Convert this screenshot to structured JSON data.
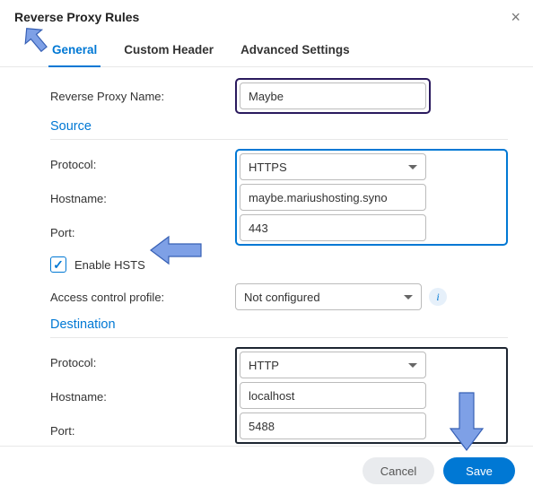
{
  "dialog": {
    "title": "Reverse Proxy Rules"
  },
  "tabs": {
    "general": "General",
    "custom_header": "Custom Header",
    "advanced": "Advanced Settings"
  },
  "fields": {
    "name_label": "Reverse Proxy Name:",
    "name_value": "Maybe",
    "source_heading": "Source",
    "protocol_label": "Protocol:",
    "src_protocol": "HTTPS",
    "hostname_label": "Hostname:",
    "src_hostname": "maybe.mariushosting.syno",
    "port_label": "Port:",
    "src_port": "443",
    "hsts_label": "Enable HSTS",
    "hsts_checked": true,
    "acp_label": "Access control profile:",
    "acp_value": "Not configured",
    "dest_heading": "Destination",
    "dst_protocol": "HTTP",
    "dst_hostname": "localhost",
    "dst_port": "5488"
  },
  "buttons": {
    "cancel": "Cancel",
    "save": "Save"
  }
}
